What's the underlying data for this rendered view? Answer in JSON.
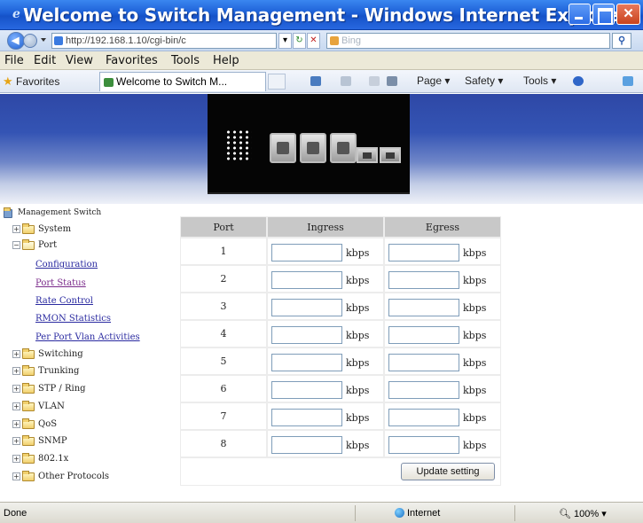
{
  "window": {
    "title": "Welcome to Switch Management - Windows Internet Explorer"
  },
  "address_bar": {
    "url": "http://192.168.1.10/cgi-bin/c",
    "search_placeholder": "Bing"
  },
  "menu": [
    "File",
    "Edit",
    "View",
    "Favorites",
    "Tools",
    "Help"
  ],
  "favorites_bar": {
    "favorites_label": "Favorites",
    "tab_title": "Welcome to Switch M...",
    "commands": [
      "Page ▾",
      "Safety ▾",
      "Tools ▾"
    ]
  },
  "sidebar": {
    "root": "Management Switch",
    "nodes": [
      "System",
      "Port",
      "Switching",
      "Trunking",
      "STP / Ring",
      "VLAN",
      "QoS",
      "SNMP",
      "802.1x",
      "Other Protocols"
    ],
    "port_children": [
      "Configuration",
      "Port Status",
      "Rate Control",
      "RMON Statistics",
      "Per Port Vlan Activities"
    ]
  },
  "rate_table": {
    "headers": [
      "Port",
      "Ingress",
      "Egress"
    ],
    "unit": "kbps",
    "ports": [
      "1",
      "2",
      "3",
      "4",
      "5",
      "6",
      "7",
      "8"
    ],
    "ingress_values": [
      "",
      "",
      "",
      "",
      "",
      "",
      "",
      ""
    ],
    "egress_values": [
      "",
      "",
      "",
      "",
      "",
      "",
      "",
      ""
    ],
    "update_button": "Update setting"
  },
  "status_bar": {
    "status": "Done",
    "zone": "Internet",
    "zoom": "100%"
  },
  "colors": {
    "titlebar": "#1c5fd6",
    "banner": "#3454b4",
    "table_header": "#c8c8c8",
    "link": "#2a2aa0"
  }
}
